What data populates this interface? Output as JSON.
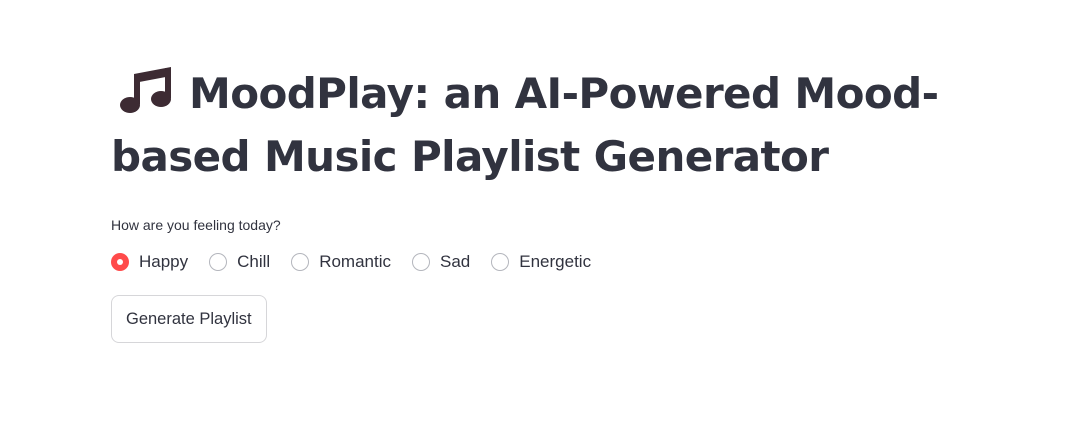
{
  "page": {
    "title": "MoodPlay: an AI-Powered Mood-based Music Playlist Generator",
    "title_icon": "music-notes-icon",
    "question": "How are you feeling today?",
    "moods": [
      {
        "label": "Happy",
        "selected": true
      },
      {
        "label": "Chill",
        "selected": false
      },
      {
        "label": "Romantic",
        "selected": false
      },
      {
        "label": "Sad",
        "selected": false
      },
      {
        "label": "Energetic",
        "selected": false
      }
    ],
    "generate_button": "Generate Playlist"
  },
  "colors": {
    "accent": "#ff4b4b",
    "text": "#31333f",
    "icon": "#3d2b33"
  }
}
